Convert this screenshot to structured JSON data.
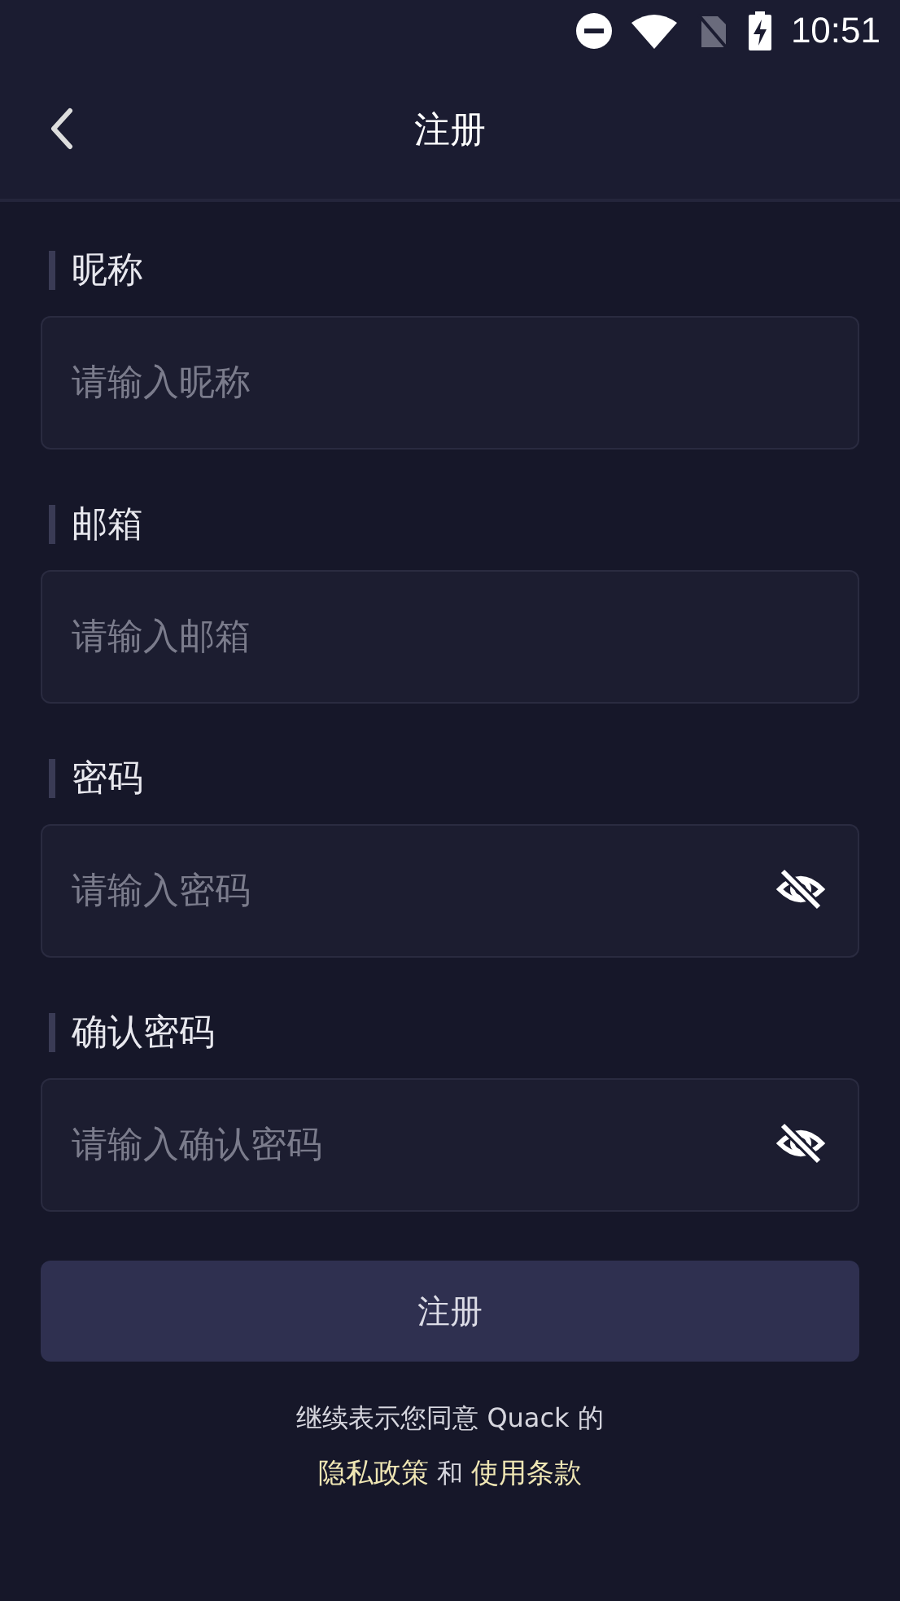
{
  "status_bar": {
    "time": "10:51"
  },
  "header": {
    "title": "注册"
  },
  "fields": [
    {
      "label": "昵称",
      "placeholder": "请输入昵称",
      "kind": "text"
    },
    {
      "label": "邮箱",
      "placeholder": "请输入邮箱",
      "kind": "text"
    },
    {
      "label": "密码",
      "placeholder": "请输入密码",
      "kind": "password",
      "masked": true
    },
    {
      "label": "确认密码",
      "placeholder": "请输入确认密码",
      "kind": "password",
      "masked": true
    }
  ],
  "submit_button": "注册",
  "footer": {
    "notice": "继续表示您同意 Quack 的",
    "privacy_link": "隐私政策",
    "conjunction": "和",
    "terms_link": "使用条款"
  }
}
